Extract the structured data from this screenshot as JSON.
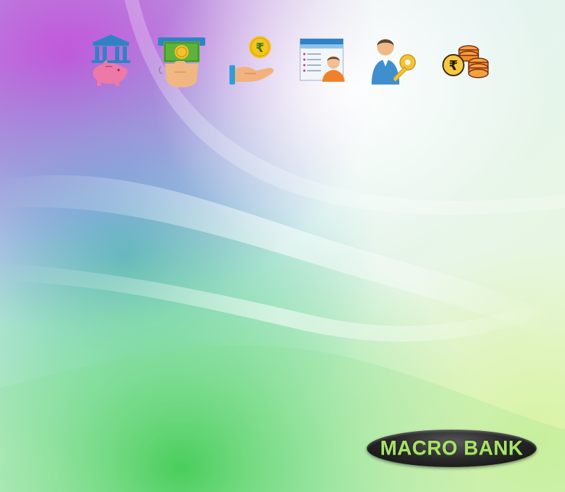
{
  "toolbar": {
    "items": [
      {
        "icon": "bank-piggy-icon",
        "label": ""
      },
      {
        "icon": "cash-deposit-icon",
        "label": ""
      },
      {
        "icon": "rupee-hand-icon",
        "label": ""
      },
      {
        "icon": "customer-record-icon",
        "label": ""
      },
      {
        "icon": "user-key-icon",
        "label": ""
      },
      {
        "icon": "rupee-coins-icon",
        "label": ""
      }
    ]
  },
  "brand": {
    "name": "MACRO BANK"
  },
  "colors": {
    "accent": "#a8e26a",
    "badge": "#1a1a1a",
    "purple": "#9b3ed0",
    "green": "#4ccf5a"
  }
}
